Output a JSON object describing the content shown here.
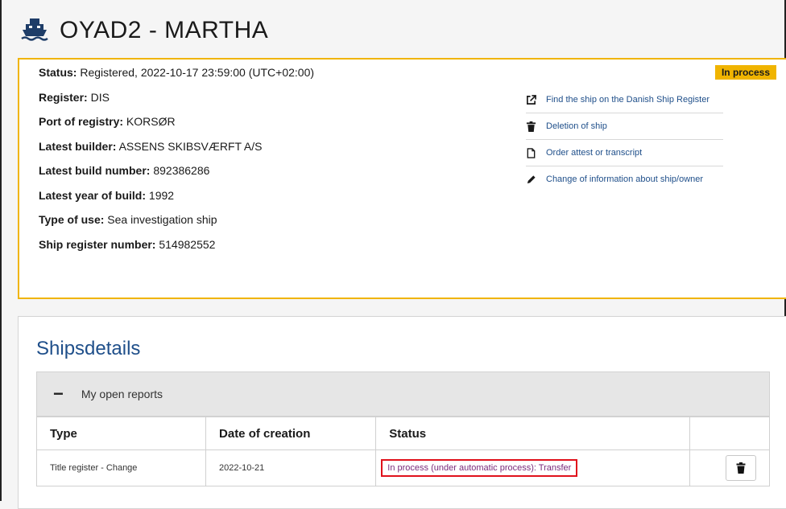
{
  "header": {
    "title": "OYAD2 - MARTHA",
    "icon": "ship-icon"
  },
  "info": {
    "badge": "In process",
    "props": [
      {
        "label": "Status:",
        "value": " Registered, 2022-10-17 23:59:00 (UTC+02:00)"
      },
      {
        "label": "Register:",
        "value": " DIS"
      },
      {
        "label": "Port of registry:",
        "value": " KORSØR"
      },
      {
        "label": "Latest builder:",
        "value": " ASSENS SKIBSVÆRFT A/S"
      },
      {
        "label": "Latest build number:",
        "value": " 892386286"
      },
      {
        "label": "Latest year of build:",
        "value": " 1992"
      },
      {
        "label": "Type of use:",
        "value": " Sea investigation ship"
      },
      {
        "label": "Ship register number:",
        "value": " 514982552"
      }
    ],
    "actions": [
      {
        "label": "Find the ship on the Danish Ship Register",
        "icon": "external-link-icon"
      },
      {
        "label": "Deletion of ship",
        "icon": "trash-icon"
      },
      {
        "label": "Order attest or transcript",
        "icon": "document-icon"
      },
      {
        "label": "Change of information about ship/owner",
        "icon": "pencil-icon"
      }
    ]
  },
  "details": {
    "title": "Shipsdetails",
    "accordion": {
      "label": "My open reports",
      "toggle": "−"
    },
    "table": {
      "headers": [
        "Type",
        "Date of creation",
        "Status",
        ""
      ],
      "rows": [
        {
          "type": "Title register - Change",
          "date": "2022-10-21",
          "status": "In process (under automatic process): Transfer"
        }
      ]
    }
  },
  "colors": {
    "accent": "#f0b400",
    "link": "#1f4f8a",
    "highlight": "#e0111b"
  }
}
